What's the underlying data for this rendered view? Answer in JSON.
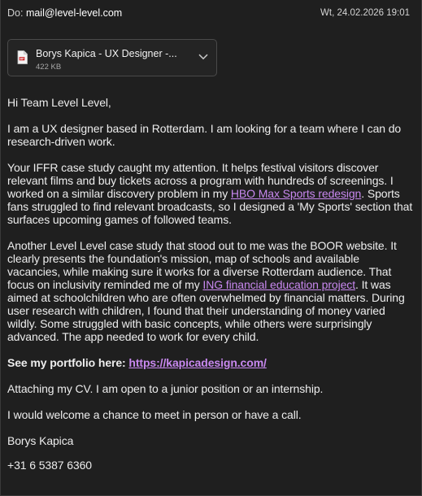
{
  "header": {
    "to_label": "Do:",
    "to_address": "mail@level-level.com",
    "date": "Wt, 24.02.2026 19:01"
  },
  "attachment": {
    "icon": "pdf-file-icon",
    "name": "Borys Kapica - UX Designer -...",
    "size": "422 KB"
  },
  "email": {
    "greeting": "Hi Team Level Level,",
    "intro": "I am a UX designer based in Rotterdam. I am looking for a team where I can do research-driven work.",
    "p2_before": "Your IFFR case study caught my attention. It helps festival visitors discover relevant films and buy tickets across a program with hundreds of screenings. I worked on a similar discovery problem in my ",
    "p2_link": "HBO Max Sports redesign",
    "p2_after": ". Sports fans struggled to find relevant broadcasts, so I designed a 'My Sports' section that surfaces upcoming games of followed teams.",
    "p3_before": "Another Level Level case study that stood out to me was the BOOR website. It clearly presents the foundation's mission, map of schools and available vacancies, while making sure it works for a diverse Rotterdam audience. That focus on inclusivity reminded me of my ",
    "p3_link": "ING financial education project",
    "p3_after": ". It was aimed at schoolchildren who are often overwhelmed by financial matters. During user research with children, I found that their understanding of money varied wildly. Some struggled with basic concepts, while others were surprisingly advanced. The app needed to work for every child.",
    "portfolio_label": "See my portfolio here: ",
    "portfolio_link": "https://kapicadesign.com/",
    "cv_line": "Attaching my CV. I am open to a junior position or an internship.",
    "closing_line": "I would welcome a chance to meet in person or have a call.",
    "signature_name": "Borys Kapica",
    "signature_phone": "+31 6 5387 6360"
  },
  "colors": {
    "background": "#1f1f1f",
    "link": "#c888ef",
    "text": "#ededed",
    "pdf_icon": "#d13438"
  }
}
